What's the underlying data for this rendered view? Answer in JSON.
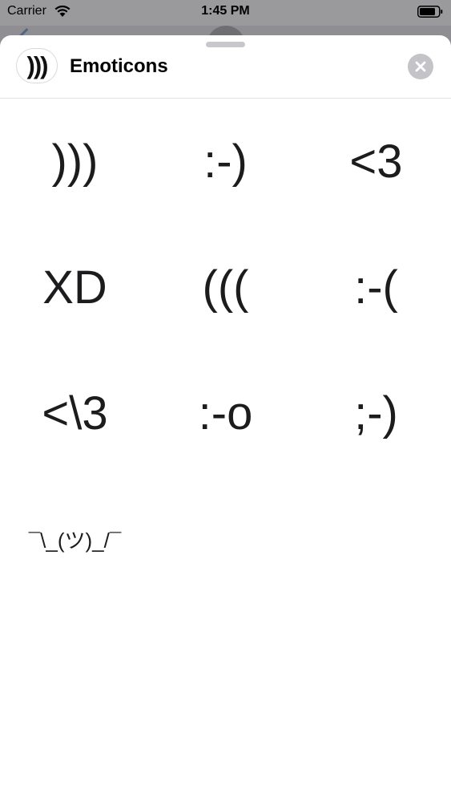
{
  "status_bar": {
    "carrier": "Carrier",
    "time": "1:45 PM",
    "icons": [
      "wifi-icon",
      "battery-icon"
    ]
  },
  "sheet": {
    "app_icon_text": ")))",
    "title": "Emoticons",
    "close_icon": "close-icon"
  },
  "emoticons": [
    ")))",
    ":-)",
    "<3",
    "XD",
    "(((",
    ":-(",
    "<\\3",
    ":-o",
    ";-)",
    "¯\\_(ツ)_/¯"
  ],
  "colors": {
    "sheet_background": "#ffffff",
    "close_button": "#c4c4c8",
    "text": "#1c1c1e"
  }
}
